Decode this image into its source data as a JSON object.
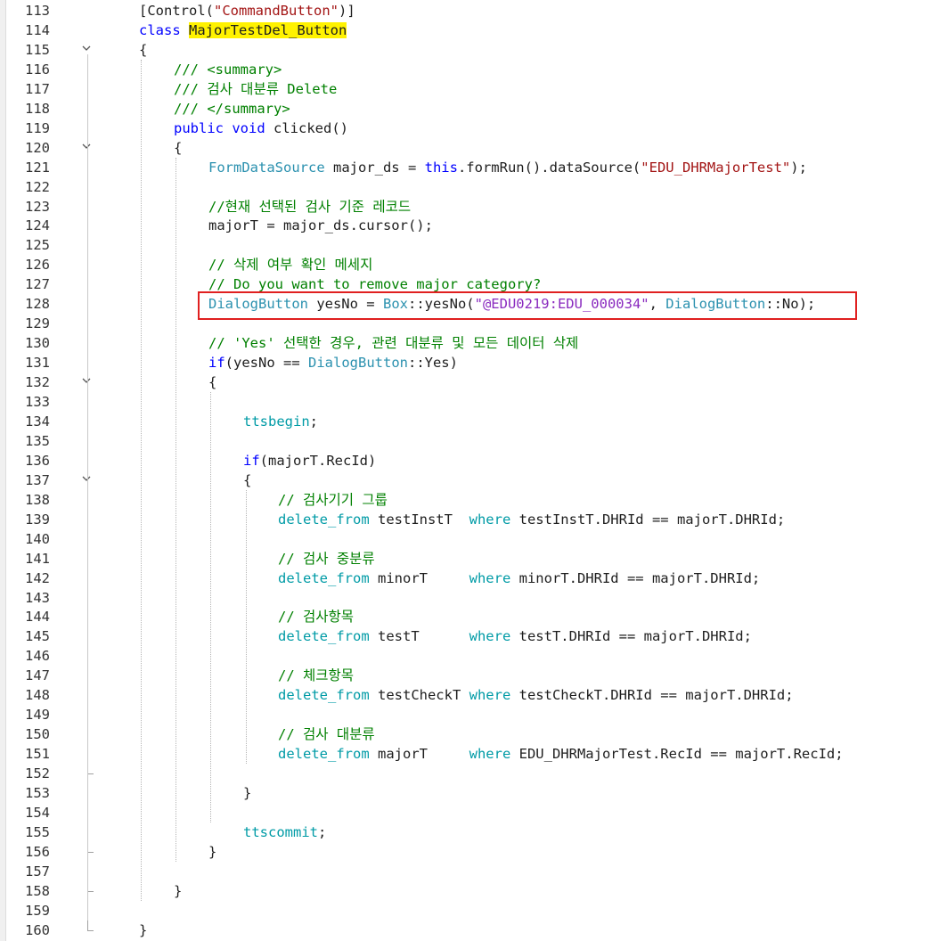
{
  "editor": {
    "first_line": 113,
    "lines": [
      {
        "n": "113",
        "fold": "none",
        "indent": 0,
        "tokens": [
          {
            "t": "[Control(",
            "c": "p"
          },
          {
            "t": "\"CommandButton\"",
            "c": "str"
          },
          {
            "t": ")]",
            "c": "p"
          }
        ]
      },
      {
        "n": "114",
        "fold": "none",
        "indent": 0,
        "tokens": [
          {
            "t": "class",
            "c": "kw"
          },
          {
            "t": " ",
            "c": "p"
          },
          {
            "t": "MajorTestDel_Button",
            "c": "hl"
          }
        ]
      },
      {
        "n": "115",
        "fold": "open",
        "indent": 0,
        "tokens": [
          {
            "t": "{",
            "c": "p"
          }
        ]
      },
      {
        "n": "116",
        "fold": "none",
        "indent": 1,
        "tokens": [
          {
            "t": "/// <summary>",
            "c": "cm"
          }
        ]
      },
      {
        "n": "117",
        "fold": "none",
        "indent": 1,
        "tokens": [
          {
            "t": "/// 검사 대분류 Delete",
            "c": "cm"
          }
        ]
      },
      {
        "n": "118",
        "fold": "none",
        "indent": 1,
        "tokens": [
          {
            "t": "/// </summary>",
            "c": "cm"
          }
        ]
      },
      {
        "n": "119",
        "fold": "none",
        "indent": 1,
        "tokens": [
          {
            "t": "public",
            "c": "kw"
          },
          {
            "t": " ",
            "c": "p"
          },
          {
            "t": "void",
            "c": "kw"
          },
          {
            "t": " clicked()",
            "c": "p"
          }
        ]
      },
      {
        "n": "120",
        "fold": "open",
        "indent": 1,
        "tokens": [
          {
            "t": "{",
            "c": "p"
          }
        ]
      },
      {
        "n": "121",
        "fold": "none",
        "indent": 2,
        "tokens": [
          {
            "t": "FormDataSource",
            "c": "ty"
          },
          {
            "t": " major_ds = ",
            "c": "p"
          },
          {
            "t": "this",
            "c": "kw"
          },
          {
            "t": ".formRun().dataSource(",
            "c": "p"
          },
          {
            "t": "\"EDU_DHRMajorTest\"",
            "c": "str"
          },
          {
            "t": ");",
            "c": "p"
          }
        ]
      },
      {
        "n": "122",
        "fold": "none",
        "indent": 2,
        "tokens": []
      },
      {
        "n": "123",
        "fold": "none",
        "indent": 2,
        "tokens": [
          {
            "t": "//현재 선택된 검사 기준 레코드",
            "c": "cm"
          }
        ]
      },
      {
        "n": "124",
        "fold": "none",
        "indent": 2,
        "tokens": [
          {
            "t": "majorT = major_ds.cursor();",
            "c": "p"
          }
        ]
      },
      {
        "n": "125",
        "fold": "none",
        "indent": 2,
        "tokens": []
      },
      {
        "n": "126",
        "fold": "none",
        "indent": 2,
        "tokens": [
          {
            "t": "// 삭제 여부 확인 메세지",
            "c": "cm"
          }
        ]
      },
      {
        "n": "127",
        "fold": "none",
        "indent": 2,
        "tokens": [
          {
            "t": "// Do you want to remove major category?",
            "c": "cm"
          }
        ]
      },
      {
        "n": "128",
        "fold": "none",
        "indent": 2,
        "tokens": [
          {
            "t": "DialogButton",
            "c": "ty"
          },
          {
            "t": " yesNo = ",
            "c": "p"
          },
          {
            "t": "Box",
            "c": "ty"
          },
          {
            "t": "::yesNo(",
            "c": "p"
          },
          {
            "t": "\"@EDU0219:EDU_000034\"",
            "c": "lbl"
          },
          {
            "t": ", ",
            "c": "p"
          },
          {
            "t": "DialogButton",
            "c": "ty"
          },
          {
            "t": "::No);",
            "c": "p"
          }
        ]
      },
      {
        "n": "129",
        "fold": "none",
        "indent": 2,
        "tokens": []
      },
      {
        "n": "130",
        "fold": "none",
        "indent": 2,
        "tokens": [
          {
            "t": "// 'Yes' 선택한 경우, 관련 대분류 및 모든 데이터 삭제",
            "c": "cm"
          }
        ]
      },
      {
        "n": "131",
        "fold": "none",
        "indent": 2,
        "tokens": [
          {
            "t": "if",
            "c": "kw"
          },
          {
            "t": "(yesNo == ",
            "c": "p"
          },
          {
            "t": "DialogButton",
            "c": "ty"
          },
          {
            "t": "::Yes)",
            "c": "p"
          }
        ]
      },
      {
        "n": "132",
        "fold": "open",
        "indent": 2,
        "tokens": [
          {
            "t": "{",
            "c": "p"
          }
        ]
      },
      {
        "n": "133",
        "fold": "none",
        "indent": 3,
        "tokens": []
      },
      {
        "n": "134",
        "fold": "none",
        "indent": 3,
        "tokens": [
          {
            "t": "ttsbegin",
            "c": "tk"
          },
          {
            "t": ";",
            "c": "p"
          }
        ]
      },
      {
        "n": "135",
        "fold": "none",
        "indent": 3,
        "tokens": []
      },
      {
        "n": "136",
        "fold": "none",
        "indent": 3,
        "tokens": [
          {
            "t": "if",
            "c": "kw"
          },
          {
            "t": "(majorT.RecId)",
            "c": "p"
          }
        ]
      },
      {
        "n": "137",
        "fold": "open",
        "indent": 3,
        "tokens": [
          {
            "t": "{",
            "c": "p"
          }
        ]
      },
      {
        "n": "138",
        "fold": "none",
        "indent": 4,
        "tokens": [
          {
            "t": "// 검사기기 그룹",
            "c": "cm"
          }
        ]
      },
      {
        "n": "139",
        "fold": "none",
        "indent": 4,
        "tokens": [
          {
            "t": "delete_from",
            "c": "tk"
          },
          {
            "t": " testInstT  ",
            "c": "p"
          },
          {
            "t": "where",
            "c": "tk"
          },
          {
            "t": " testInstT.DHRId == majorT.DHRId;",
            "c": "p"
          }
        ]
      },
      {
        "n": "140",
        "fold": "none",
        "indent": 4,
        "tokens": []
      },
      {
        "n": "141",
        "fold": "none",
        "indent": 4,
        "tokens": [
          {
            "t": "// 검사 중분류",
            "c": "cm"
          }
        ]
      },
      {
        "n": "142",
        "fold": "none",
        "indent": 4,
        "tokens": [
          {
            "t": "delete_from",
            "c": "tk"
          },
          {
            "t": " minorT     ",
            "c": "p"
          },
          {
            "t": "where",
            "c": "tk"
          },
          {
            "t": " minorT.DHRId == majorT.DHRId;",
            "c": "p"
          }
        ]
      },
      {
        "n": "143",
        "fold": "none",
        "indent": 4,
        "tokens": []
      },
      {
        "n": "144",
        "fold": "none",
        "indent": 4,
        "tokens": [
          {
            "t": "// 검사항목",
            "c": "cm"
          }
        ]
      },
      {
        "n": "145",
        "fold": "none",
        "indent": 4,
        "tokens": [
          {
            "t": "delete_from",
            "c": "tk"
          },
          {
            "t": " testT      ",
            "c": "p"
          },
          {
            "t": "where",
            "c": "tk"
          },
          {
            "t": " testT.DHRId == majorT.DHRId;",
            "c": "p"
          }
        ]
      },
      {
        "n": "146",
        "fold": "none",
        "indent": 4,
        "tokens": []
      },
      {
        "n": "147",
        "fold": "none",
        "indent": 4,
        "tokens": [
          {
            "t": "// 체크항목",
            "c": "cm"
          }
        ]
      },
      {
        "n": "148",
        "fold": "none",
        "indent": 4,
        "tokens": [
          {
            "t": "delete_from",
            "c": "tk"
          },
          {
            "t": " testCheckT ",
            "c": "p"
          },
          {
            "t": "where",
            "c": "tk"
          },
          {
            "t": " testCheckT.DHRId == majorT.DHRId;",
            "c": "p"
          }
        ]
      },
      {
        "n": "149",
        "fold": "none",
        "indent": 4,
        "tokens": []
      },
      {
        "n": "150",
        "fold": "none",
        "indent": 4,
        "tokens": [
          {
            "t": "// 검사 대분류",
            "c": "cm"
          }
        ]
      },
      {
        "n": "151",
        "fold": "none",
        "indent": 4,
        "tokens": [
          {
            "t": "delete_from",
            "c": "tk"
          },
          {
            "t": " majorT     ",
            "c": "p"
          },
          {
            "t": "where",
            "c": "tk"
          },
          {
            "t": " EDU_DHRMajorTest.RecId == majorT.RecId;",
            "c": "p"
          }
        ]
      },
      {
        "n": "152",
        "fold": "end",
        "indent": 4,
        "tokens": []
      },
      {
        "n": "153",
        "fold": "none",
        "indent": 3,
        "tokens": [
          {
            "t": "}",
            "c": "p"
          }
        ]
      },
      {
        "n": "154",
        "fold": "none",
        "indent": 3,
        "tokens": []
      },
      {
        "n": "155",
        "fold": "none",
        "indent": 3,
        "tokens": [
          {
            "t": "ttscommit",
            "c": "tk"
          },
          {
            "t": ";",
            "c": "p"
          }
        ]
      },
      {
        "n": "156",
        "fold": "end",
        "indent": 2,
        "tokens": [
          {
            "t": "}",
            "c": "p"
          }
        ]
      },
      {
        "n": "157",
        "fold": "none",
        "indent": 2,
        "tokens": []
      },
      {
        "n": "158",
        "fold": "end",
        "indent": 1,
        "tokens": [
          {
            "t": "}",
            "c": "p"
          }
        ]
      },
      {
        "n": "159",
        "fold": "none",
        "indent": 1,
        "tokens": []
      },
      {
        "n": "160",
        "fold": "end",
        "indent": 0,
        "tokens": [
          {
            "t": "}",
            "c": "p"
          }
        ]
      }
    ],
    "highlight_box_line": "128",
    "colors": {
      "keyword": "#0000ff",
      "type": "#2b91af",
      "tts_keyword": "#009ba6",
      "string": "#a31515",
      "label": "#8a2bbf",
      "comment": "#008000",
      "highlight": "#fff200",
      "box": "#e02020"
    },
    "icons": {
      "fold_open": "chevron-down-icon",
      "fold_end": "fold-end-marker"
    }
  }
}
